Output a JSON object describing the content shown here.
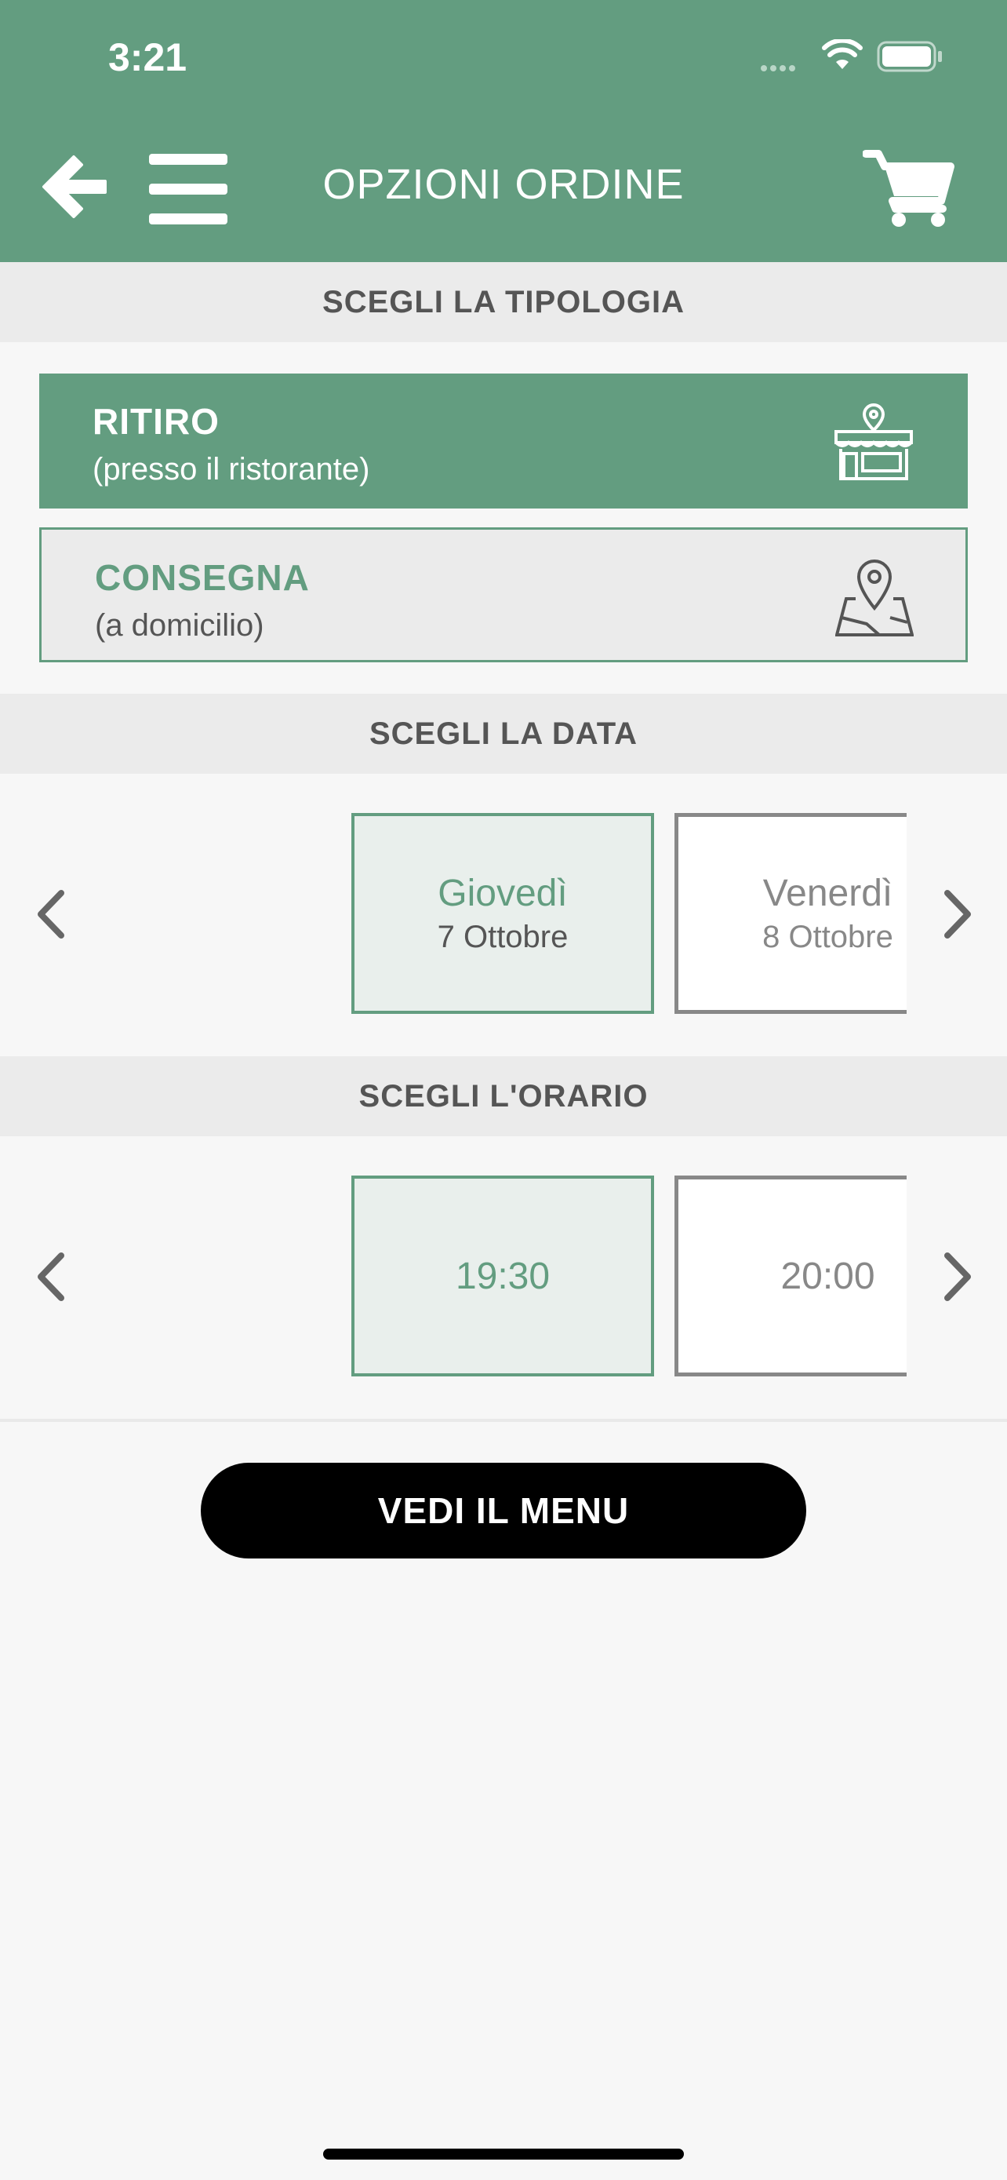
{
  "status_bar": {
    "time": "3:21"
  },
  "header": {
    "title": "OPZIONI ORDINE",
    "icons": [
      "back-arrow-icon",
      "hamburger-menu-icon",
      "cart-icon"
    ]
  },
  "type_section": {
    "heading": "SCEGLI LA TIPOLOGIA",
    "options": [
      {
        "title": "RITIRO",
        "subtitle": "(presso il ristorante)",
        "icon": "shop-location-icon",
        "selected": true
      },
      {
        "title": "CONSEGNA",
        "subtitle": "(a domicilio)",
        "icon": "map-pin-icon",
        "selected": false
      }
    ]
  },
  "date_section": {
    "heading": "SCEGLI LA DATA",
    "dates": [
      {
        "day": "Giovedì",
        "date": "7 Ottobre",
        "selected": true
      },
      {
        "day": "Venerdì",
        "date": "8 Ottobre",
        "selected": false
      }
    ]
  },
  "time_section": {
    "heading": "SCEGLI L'ORARIO",
    "times": [
      {
        "time": "19:30",
        "selected": true
      },
      {
        "time": "20:00",
        "selected": false
      }
    ]
  },
  "cta": {
    "label": "VEDI IL MENU"
  },
  "colors": {
    "accent": "#639d80",
    "section_bg": "#ebebeb",
    "text_dark": "#555555",
    "button_bg": "#000000"
  }
}
